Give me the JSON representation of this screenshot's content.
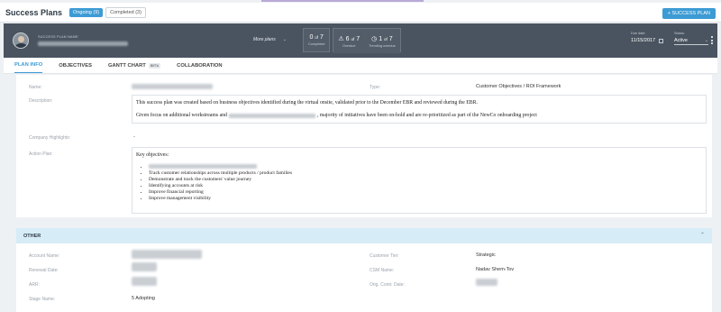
{
  "topbar": {
    "title": "Success Plans",
    "tabs": [
      {
        "label": "Ongoing (9)",
        "active": true
      },
      {
        "label": "Completed (3)",
        "active": false
      }
    ],
    "add_button": "+ SUCCESS PLAN"
  },
  "header": {
    "plan_name_label": "SUCCESS PLAN NAME",
    "more_plans": "More plans",
    "stats": [
      {
        "value": "0",
        "total": "7",
        "label": "Completed"
      },
      {
        "value": "6",
        "total": "7",
        "label": "Overdue"
      },
      {
        "value": "1",
        "total": "7",
        "label": "Trending overdue"
      }
    ],
    "due_date_label": "Due date:",
    "due_date": "11/15/2017",
    "status_label": "Status:",
    "status": "Active"
  },
  "tabs": [
    {
      "label": "PLAN INFO",
      "active": true
    },
    {
      "label": "OBJECTIVES",
      "active": false
    },
    {
      "label": "GANTT CHART",
      "badge": "BETA",
      "active": false
    },
    {
      "label": "COLLABORATION",
      "active": false
    }
  ],
  "plan_info": {
    "name_label": "Name:",
    "type_label": "Type:",
    "type_value": "Customer Objectives / ROI Framework",
    "description_label": "Description:",
    "description_p1": "This success plan was created based on business objectives identified during the virtual onsite, validated prior to the December EBR and reviewed during the EBR.",
    "description_p2_start": "Given focus on additional workstreams and",
    "description_p2_end": ", majority of initiatives have been on-hold and are re-prioritized as part of the NewCo onboarding project",
    "highlights_label": "Company Highlights:",
    "highlights_value": "-",
    "action_plan_label": "Action Plan:",
    "action_plan_heading": "Key objectives:",
    "objectives": [
      "Track customer relationships across multiple products / product families",
      "Demonstrate and track the customers' value journey",
      "Identifying accounts at risk",
      "Improve financial reporting",
      "Improve management visibility"
    ]
  },
  "other": {
    "title": "OTHER",
    "account_name_label": "Account Name:",
    "renewal_date_label": "Renewal Date:",
    "arr_label": "ARR:",
    "stage_name_label": "Stage Name:",
    "stage_name": "5 Adopting",
    "customer_tier_label": "Customer Tier:",
    "customer_tier": "Strategic",
    "csm_name_label": "CSM Name:",
    "csm_name": "Nadav Shem-Tov",
    "orig_contr_date_label": "Orig. Contr. Date:"
  }
}
